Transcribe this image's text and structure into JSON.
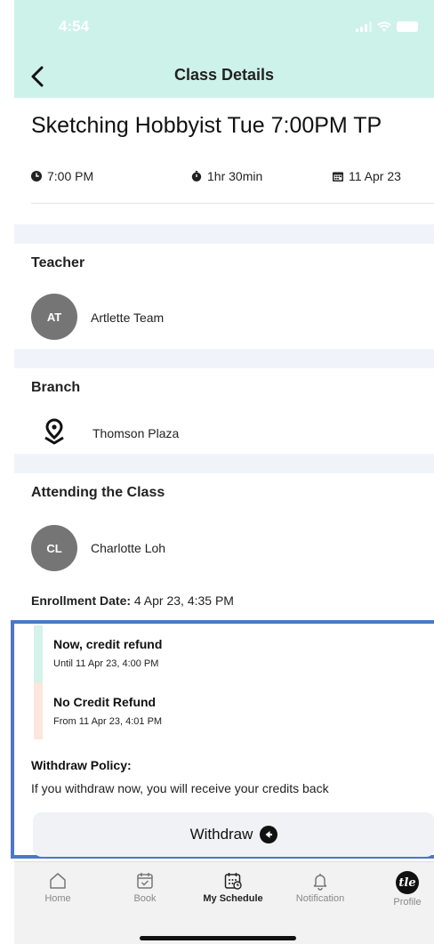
{
  "status_bar": {
    "time": "4:54"
  },
  "nav": {
    "title": "Class Details"
  },
  "class": {
    "title": "Sketching Hobbyist Tue 7:00PM TP",
    "time": "7:00 PM",
    "duration": "1hr 30min",
    "date": "11 Apr 23"
  },
  "teacher": {
    "heading": "Teacher",
    "initials": "AT",
    "name": "Artlette Team"
  },
  "branch": {
    "heading": "Branch",
    "name": "Thomson Plaza"
  },
  "attendee": {
    "heading": "Attending the Class",
    "initials": "CL",
    "name": "Charlotte Loh"
  },
  "enrollment": {
    "label": "Enrollment Date:",
    "value": " 4 Apr 23, 4:35 PM"
  },
  "refund": {
    "items": [
      {
        "title": "Now, credit refund",
        "sub": "Until 11 Apr 23, 4:00 PM"
      },
      {
        "title": "No Credit Refund",
        "sub": "From 11 Apr 23, 4:01 PM"
      }
    ]
  },
  "policy": {
    "heading": "Withdraw Policy:",
    "text": "If you withdraw now, you will receive your credits back"
  },
  "withdraw_button": {
    "label": "Withdraw"
  },
  "tabs": [
    {
      "label": "Home",
      "icon": "home-icon"
    },
    {
      "label": "Book",
      "icon": "calendar-check-icon"
    },
    {
      "label": "My Schedule",
      "icon": "schedule-icon",
      "active": true
    },
    {
      "label": "Notification",
      "icon": "bell-icon"
    },
    {
      "label": "Profile",
      "icon": "profile-logo-icon",
      "logo_text": "tle"
    }
  ],
  "colors": {
    "header_bg": "#cdf2ea",
    "section_gap": "#f0f4fa",
    "highlight_border": "#4a78c4",
    "refund_now": "#d5f2eb",
    "refund_none": "#fde6dd",
    "avatar": "#757575"
  }
}
